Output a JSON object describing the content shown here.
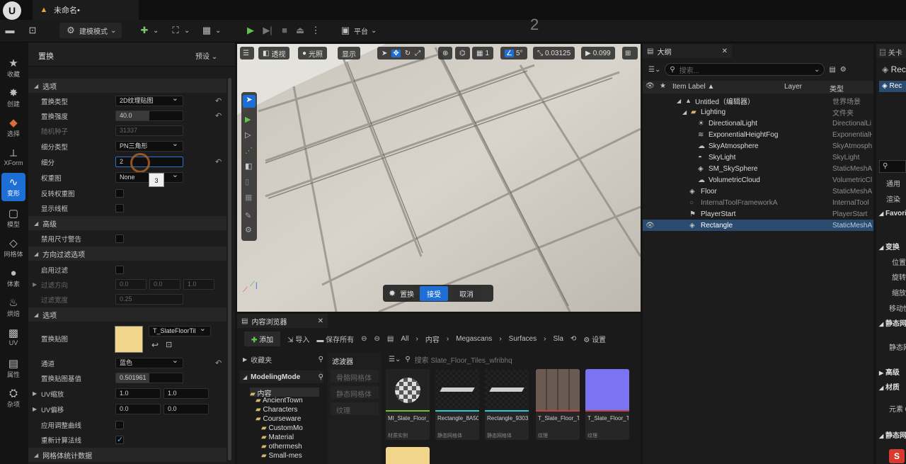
{
  "titlebar": {
    "title": "未命名•"
  },
  "toolbar": {
    "mode_label": "建模模式",
    "platform_label": "平台",
    "overlay_number": "2"
  },
  "modes": [
    {
      "label": "收藏",
      "icon": "star-icon"
    },
    {
      "label": "创建",
      "icon": "create-icon"
    },
    {
      "label": "选择",
      "icon": "select-icon"
    },
    {
      "label": "XForm",
      "icon": "xform-icon"
    },
    {
      "label": "变形",
      "icon": "deform-icon"
    },
    {
      "label": "模型",
      "icon": "model-icon"
    },
    {
      "label": "网格体",
      "icon": "mesh-icon"
    },
    {
      "label": "体素",
      "icon": "voxel-icon"
    },
    {
      "label": "烘焙",
      "icon": "bake-icon"
    },
    {
      "label": "UV",
      "icon": "uv-icon"
    },
    {
      "label": "属性",
      "icon": "attributes-icon"
    },
    {
      "label": "杂项",
      "icon": "misc-icon"
    }
  ],
  "panel": {
    "title": "置换",
    "preset": "预设",
    "sections": {
      "options": "选项",
      "advanced": "高级",
      "direction_filter": "方向过滤选项",
      "options2": "选项",
      "mesh_stats": "网格体统计数据"
    },
    "fields": {
      "displace_type_label": "置换类型",
      "displace_type_value": "2D纹理贴图",
      "strength_label": "置换强度",
      "strength_value": "40.0",
      "seed_label": "随机种子",
      "seed_value": "31337",
      "subdiv_type_label": "细分类型",
      "subdiv_type_value": "PN三角形",
      "subdiv_label": "细分",
      "subdiv_value": "2",
      "weightmap_label": "权重图",
      "weightmap_value": "None",
      "tooltip_value": "3",
      "invert_weight_label": "反转权重图",
      "show_wire_label": "显示线框",
      "disable_size_warning_label": "禁用尺寸警告",
      "enable_filter_label": "启用过滤",
      "filter_dir_label": "过滤方向",
      "filter_dir_x": "0.0",
      "filter_dir_y": "0.0",
      "filter_dir_z": "1.0",
      "filter_width_label": "过滤宽度",
      "filter_width_value": "0.25",
      "displace_map_label": "置换贴图",
      "displace_map_value": "T_SlateFloorTil",
      "channel_label": "通道",
      "channel_value": "蓝色",
      "map_base_label": "置换贴图基值",
      "map_base_value": "0.501961",
      "uv_scale_label": "UV缩放",
      "uv_scale_x": "1.0",
      "uv_scale_y": "1.0",
      "uv_offset_label": "UV偏移",
      "uv_offset_x": "0.0",
      "uv_offset_y": "0.0",
      "adjust_curve_label": "应用调整曲线",
      "recompute_normals_label": "重新计算法线"
    }
  },
  "viewport": {
    "perspective": "透视",
    "lit": "光照",
    "show": "显示",
    "grid": "1",
    "angle": "5°",
    "scale": "0.03125",
    "camera_speed": "0.099",
    "action_label": "置换",
    "accept": "接受",
    "cancel": "取消"
  },
  "content": {
    "tab_title": "内容浏览器",
    "add": "添加",
    "import": "导入",
    "save_all": "保存所有",
    "breadcrumb": [
      "All",
      "内容",
      "Megascans",
      "Surfaces",
      "Sla"
    ],
    "settings": "设置",
    "favorites": "收藏夹",
    "root": "ModelingMode",
    "tree": [
      "内容",
      "AncientTown",
      "Characters",
      "Courseware",
      "CustomMo",
      "Material",
      "othermesh",
      "Small-mes"
    ],
    "filters_title": "滤波器",
    "filters": [
      "骨骼网格体",
      "静态网格体",
      "纹理"
    ],
    "search_placeholder": "搜索 Slate_Floor_Tiles_wfribhq",
    "assets": [
      {
        "name": "MI_Slate_Floor_Tiles_",
        "type": "材质实例",
        "color": "#6fbf3b"
      },
      {
        "name": "Rectangle_8A50E1A4",
        "type": "静态网格体",
        "color": "#32c8d8"
      },
      {
        "name": "Rectangle_9303BAAC",
        "type": "静态网格体",
        "color": "#32c8d8"
      },
      {
        "name": "T_Slate_Floor_Tiles_wfribhq",
        "type": "纹理",
        "color": "#c44040"
      },
      {
        "name": "T_Slate_Floor_Tiles_wfribhq",
        "type": "纹理",
        "color": "#c44040"
      }
    ]
  },
  "outliner": {
    "tab_title": "大纲",
    "search_placeholder": "搜索...",
    "col_label": "Item Label ▲",
    "col_layer": "Layer",
    "col_type": "类型",
    "rows": [
      {
        "name": "Untitled（编辑器）",
        "type": "世界场景",
        "indent": 0
      },
      {
        "name": "Lighting",
        "type": "文件夹",
        "indent": 1
      },
      {
        "name": "DirectionalLight",
        "type": "DirectionalLi",
        "indent": 2
      },
      {
        "name": "ExponentialHeightFog",
        "type": "ExponentialH",
        "indent": 2
      },
      {
        "name": "SkyAtmosphere",
        "type": "SkyAtmosph",
        "indent": 2
      },
      {
        "name": "SkyLight",
        "type": "SkyLight",
        "indent": 2
      },
      {
        "name": "SM_SkySphere",
        "type": "StaticMeshA",
        "indent": 2
      },
      {
        "name": "VolumetricCloud",
        "type": "VolumetricCl",
        "indent": 2
      },
      {
        "name": "Floor",
        "type": "StaticMeshA",
        "indent": 1
      },
      {
        "name": "InternalToolFrameworkA",
        "type": "InternalTool",
        "indent": 1
      },
      {
        "name": "PlayerStart",
        "type": "PlayerStart",
        "indent": 1
      },
      {
        "name": "Rectangle",
        "type": "StaticMeshA",
        "indent": 1
      }
    ]
  },
  "details": {
    "tab_title": "关卡",
    "selected": "Rec",
    "items": [
      "通用",
      "渲染",
      "Favori",
      "变换",
      "位置",
      "旋转",
      "缩放",
      "移动性",
      "静态网",
      "静态网",
      "高级",
      "材质",
      "元素 0",
      "静态网"
    ]
  },
  "colors": {
    "accent": "#1d6fd6",
    "selection": "#2a4a6e"
  }
}
